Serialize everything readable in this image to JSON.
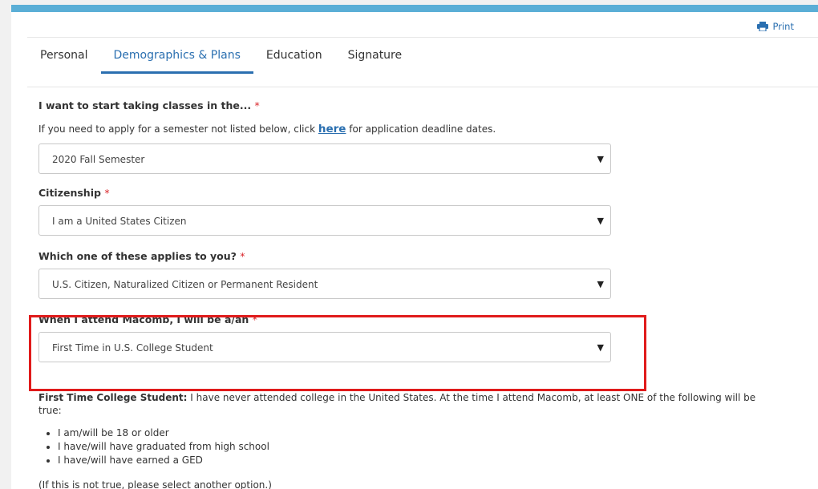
{
  "header": {
    "print_label": "Print"
  },
  "tabs": [
    {
      "label": "Personal",
      "active": false
    },
    {
      "label": "Demographics & Plans",
      "active": true
    },
    {
      "label": "Education",
      "active": false
    },
    {
      "label": "Signature",
      "active": false
    }
  ],
  "form": {
    "semester": {
      "label": "I want to start taking classes in the...",
      "required_mark": "*",
      "help_prefix": "If you need to apply for a semester not listed below, click ",
      "help_link": "here",
      "help_suffix": " for application deadline dates.",
      "value": "2020 Fall Semester"
    },
    "citizenship": {
      "label": "Citizenship",
      "required_mark": "*",
      "value": "I am a United States Citizen"
    },
    "applies": {
      "label": "Which one of these applies to you?",
      "required_mark": "*",
      "value": "U.S. Citizen, Naturalized Citizen or Permanent Resident"
    },
    "attend": {
      "label": "When I attend Macomb, I will be a/an",
      "required_mark": "*",
      "value": "First Time in U.S. College Student"
    }
  },
  "info": {
    "title": "First Time College Student:",
    "text": " I have never attended college in the United States. At the time I attend Macomb, at least ONE of the following will be true:",
    "bullets": [
      "I am/will be 18 or older",
      "I have/will have graduated from high school",
      "I have/will have earned a GED"
    ],
    "note": "(If this is not true, please select another option.)"
  },
  "colors": {
    "accent": "#2a6fb0",
    "top_bar": "#5aaed6",
    "required": "#d9262b",
    "highlight": "#e01b1b"
  }
}
